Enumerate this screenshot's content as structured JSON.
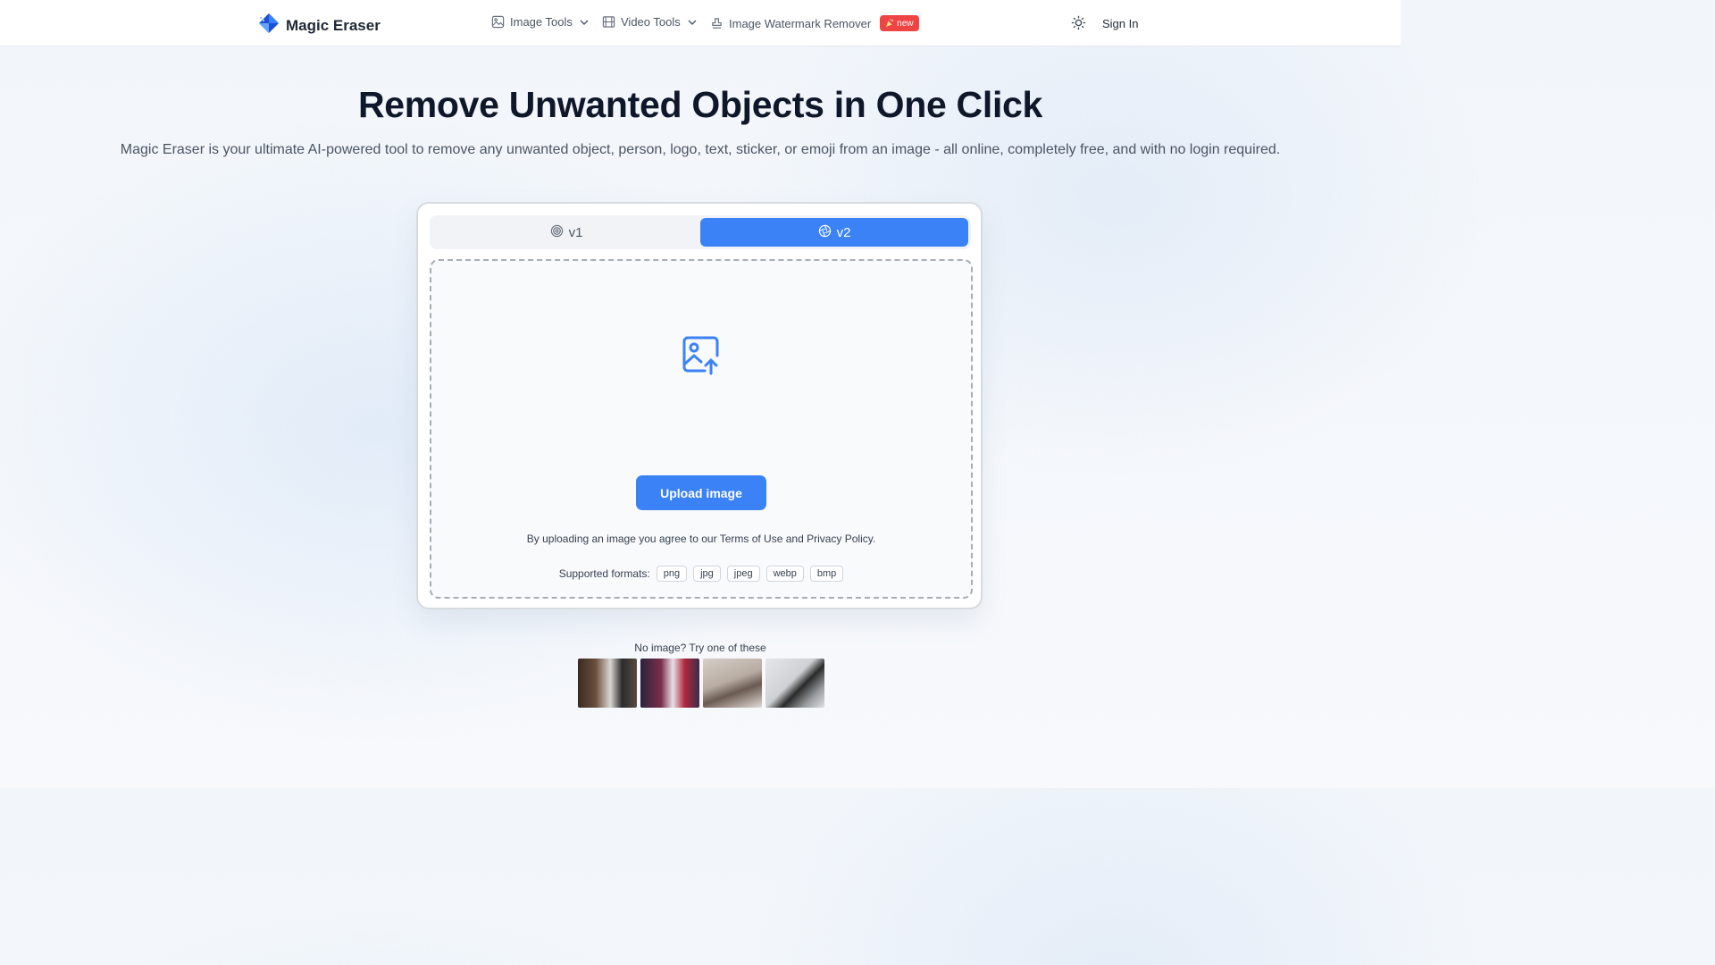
{
  "header": {
    "brand": "Magic Eraser",
    "nav": [
      {
        "label": "Image Tools",
        "icon": "image-icon",
        "dropdown": true
      },
      {
        "label": "Video Tools",
        "icon": "film-icon",
        "dropdown": true
      },
      {
        "label": "Image Watermark Remover",
        "icon": "stamp-icon",
        "badge": "new"
      }
    ],
    "theme_icon": "sun-icon",
    "sign_in": "Sign In"
  },
  "hero": {
    "title": "Remove Unwanted Objects in One Click",
    "subtitle": "Magic Eraser is your ultimate AI-powered tool to remove any unwanted object, person, logo, text, sticker, or emoji from an image - all online, completely free, and with no login required."
  },
  "tool": {
    "tabs": [
      {
        "label": "v1",
        "active": false
      },
      {
        "label": "v2",
        "active": true
      }
    ],
    "upload_button": "Upload image",
    "terms": "By uploading an image you agree to our Terms of Use and Privacy Policy.",
    "formats_label": "Supported formats:",
    "formats": [
      "png",
      "jpg",
      "jpeg",
      "webp",
      "bmp"
    ]
  },
  "samples": {
    "label": "No image? Try one of these",
    "count": 4
  },
  "colors": {
    "accent": "#3b82f6",
    "badge": "#ef4444",
    "title": "#0f172a"
  }
}
